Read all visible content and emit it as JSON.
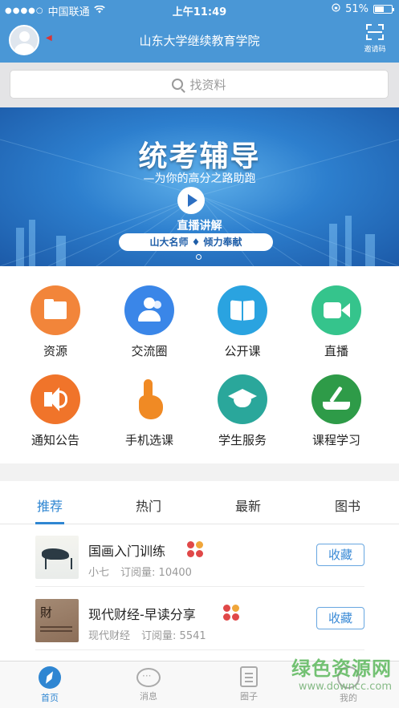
{
  "status_bar": {
    "signal_dots": "●●●●○",
    "carrier": "中国联通",
    "time": "上午11:49",
    "battery_percent": "51%"
  },
  "header": {
    "title": "山东大学继续教育学院",
    "scan_label": "邀请码"
  },
  "search": {
    "placeholder": "找资料"
  },
  "banner": {
    "title": "统考辅导",
    "subtitle": "—为你的高分之路助跑",
    "live_label": "直播讲解",
    "pill_text": "山大名师 ♦ 倾力奉献"
  },
  "grid": [
    {
      "label": "资源",
      "icon": "folder-icon",
      "color": "#f2853a"
    },
    {
      "label": "交流圈",
      "icon": "users-icon",
      "color": "#3a86e8"
    },
    {
      "label": "公开课",
      "icon": "book-icon",
      "color": "#2aa3e0"
    },
    {
      "label": "直播",
      "icon": "video-icon",
      "color": "#35c48c"
    },
    {
      "label": "通知公告",
      "icon": "speaker-icon",
      "color": "#f0742a"
    },
    {
      "label": "手机选课",
      "icon": "hand-tap-icon",
      "color": "#f08a24"
    },
    {
      "label": "学生服务",
      "icon": "graduation-cap-icon",
      "color": "#2aa79b"
    },
    {
      "label": "课程学习",
      "icon": "study-book-icon",
      "color": "#2e9b48"
    }
  ],
  "tabs": [
    "推荐",
    "热门",
    "最新",
    "图书"
  ],
  "active_tab": "推荐",
  "list": [
    {
      "title": "国画入门训练",
      "author": "小七",
      "subs_label": "订阅量:",
      "subs": "10400",
      "button": "收藏"
    },
    {
      "title": "现代财经-早读分享",
      "author": "现代财经",
      "subs_label": "订阅量:",
      "subs": "5541",
      "button": "收藏"
    }
  ],
  "tab_bar": [
    {
      "label": "首页",
      "icon": "compass-icon",
      "active": true
    },
    {
      "label": "消息",
      "icon": "chat-icon",
      "active": false
    },
    {
      "label": "圈子",
      "icon": "circle-icon",
      "active": false
    },
    {
      "label": "我的",
      "icon": "profile-icon",
      "active": false
    }
  ],
  "watermark": {
    "title": "绿色资源网",
    "url": "www.downcc.com"
  },
  "colors": {
    "primary": "#4a97d6",
    "accent": "#2f86d2"
  }
}
